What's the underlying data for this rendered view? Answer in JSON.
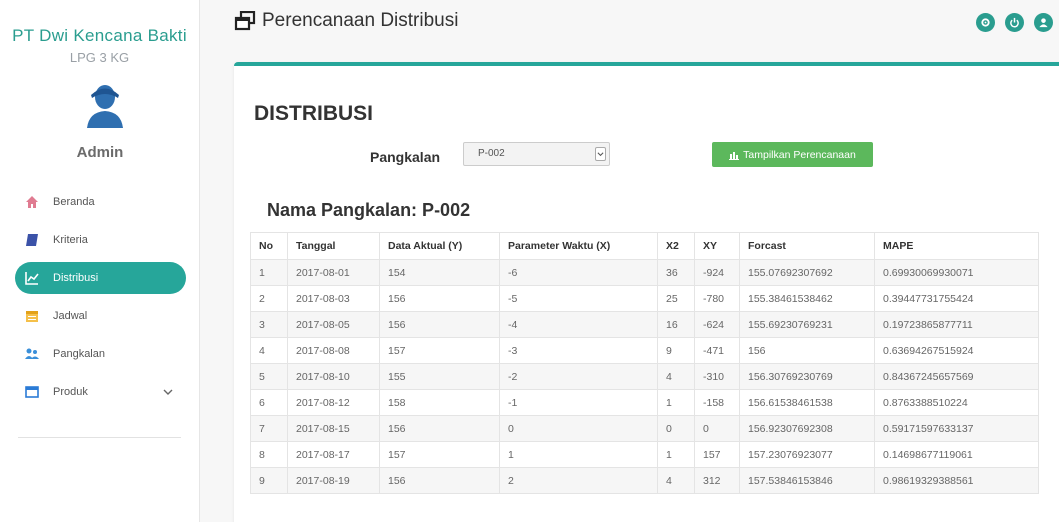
{
  "sidebar": {
    "brand": "PT Dwi Kencana Bakti",
    "brand_sub": "LPG 3 KG",
    "user": "Admin",
    "items": [
      {
        "label": "Beranda",
        "icon": "home-icon"
      },
      {
        "label": "Kriteria",
        "icon": "book-icon"
      },
      {
        "label": "Distribusi",
        "icon": "chart-line-icon",
        "active": true
      },
      {
        "label": "Jadwal",
        "icon": "calendar-icon"
      },
      {
        "label": "Pangkalan",
        "icon": "users-icon"
      },
      {
        "label": "Produk",
        "icon": "window-icon"
      }
    ]
  },
  "header": {
    "title": "Perencanaan Distribusi",
    "icons": [
      "settings-icon",
      "power-icon",
      "user-icon"
    ]
  },
  "main": {
    "section_title": "DISTRIBUSI",
    "pangkalan_label": "Pangkalan",
    "pangkalan_selected": "P-002",
    "button_label": "Tampilkan Perencanaan",
    "table_title": "Nama Pangkalan: P-002",
    "columns": [
      "No",
      "Tanggal",
      "Data Aktual (Y)",
      "Parameter Waktu (X)",
      "X2",
      "XY",
      "Forcast",
      "MAPE"
    ],
    "rows": [
      [
        "1",
        "2017-08-01",
        "154",
        "-6",
        "36",
        "-924",
        "155.07692307692",
        "0.69930069930071"
      ],
      [
        "2",
        "2017-08-03",
        "156",
        "-5",
        "25",
        "-780",
        "155.38461538462",
        "0.39447731755424"
      ],
      [
        "3",
        "2017-08-05",
        "156",
        "-4",
        "16",
        "-624",
        "155.69230769231",
        "0.19723865877711"
      ],
      [
        "4",
        "2017-08-08",
        "157",
        "-3",
        "9",
        "-471",
        "156",
        "0.63694267515924"
      ],
      [
        "5",
        "2017-08-10",
        "155",
        "-2",
        "4",
        "-310",
        "156.30769230769",
        "0.84367245657569"
      ],
      [
        "6",
        "2017-08-12",
        "158",
        "-1",
        "1",
        "-158",
        "156.61538461538",
        "0.8763388510224"
      ],
      [
        "7",
        "2017-08-15",
        "156",
        "0",
        "0",
        "0",
        "156.92307692308",
        "0.59171597633137"
      ],
      [
        "8",
        "2017-08-17",
        "157",
        "1",
        "1",
        "157",
        "157.23076923077",
        "0.14698677119061"
      ],
      [
        "9",
        "2017-08-19",
        "156",
        "2",
        "4",
        "312",
        "157.53846153846",
        "0.98619329388561"
      ]
    ]
  },
  "colors": {
    "accent": "#26a69a",
    "button": "#5cb85c"
  }
}
